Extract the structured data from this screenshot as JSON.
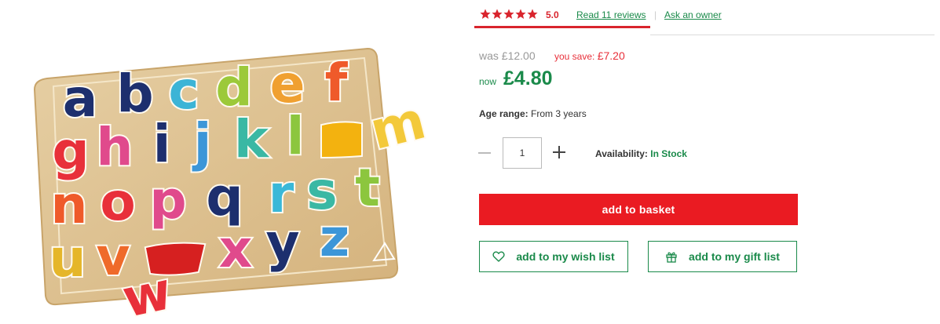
{
  "product": {
    "image_alt": "wooden alphabet puzzle"
  },
  "rating": {
    "stars": 5,
    "score": "5.0",
    "reviews_link": "Read 11 reviews",
    "separator": "|",
    "ask_link": "Ask an owner",
    "star_color": "#d9242d"
  },
  "price": {
    "was_label": "was £12.00",
    "save_label": "you save:",
    "save_amount": "£7.20",
    "now_label": "now",
    "now_price": "£4.80"
  },
  "details": {
    "age_label": "Age range:",
    "age_value": "From 3 years"
  },
  "quantity": {
    "value": "1"
  },
  "availability": {
    "label": "Availability:",
    "value": "In Stock"
  },
  "actions": {
    "basket_label": "add to basket",
    "wish_label": "add to my wish list",
    "gift_label": "add to my gift list"
  },
  "colors": {
    "accent_red": "#ea1b22",
    "accent_green": "#1a8a4a"
  },
  "icons": [
    "star-icon",
    "minus-icon",
    "plus-icon",
    "heart-icon",
    "gift-icon"
  ]
}
